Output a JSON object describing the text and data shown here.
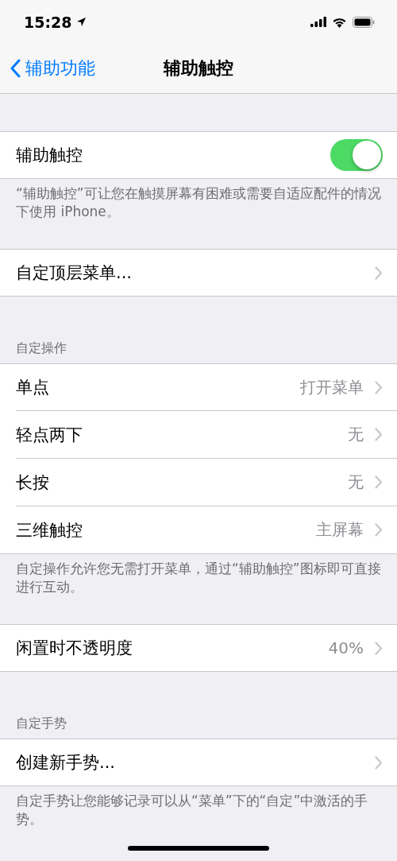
{
  "status_bar": {
    "time": "15:28"
  },
  "nav": {
    "back": "辅助功能",
    "title": "辅助触控"
  },
  "sections": [
    {
      "rows": [
        {
          "kind": "toggle",
          "label": "辅助触控",
          "on": true
        }
      ],
      "footer": "“辅助触控”可让您在触摸屏幕有困难或需要自适应配件的情况下使用 iPhone。"
    },
    {
      "rows": [
        {
          "kind": "link",
          "label": "自定顶层菜单..."
        }
      ]
    },
    {
      "header": "自定操作",
      "rows": [
        {
          "kind": "link",
          "label": "单点",
          "value": "打开菜单"
        },
        {
          "kind": "link",
          "label": "轻点两下",
          "value": "无"
        },
        {
          "kind": "link",
          "label": "长按",
          "value": "无"
        },
        {
          "kind": "link",
          "label": "三维触控",
          "value": "主屏幕"
        }
      ],
      "footer": "自定操作允许您无需打开菜单，通过“辅助触控”图标即可直接进行互动。"
    },
    {
      "rows": [
        {
          "kind": "link",
          "label": "闲置时不透明度",
          "value": "40%"
        }
      ]
    },
    {
      "header": "自定手势",
      "rows": [
        {
          "kind": "link",
          "label": "创建新手势..."
        }
      ],
      "footer": "自定手势让您能够记录可以从“菜单”下的“自定”中激活的手势。"
    }
  ]
}
